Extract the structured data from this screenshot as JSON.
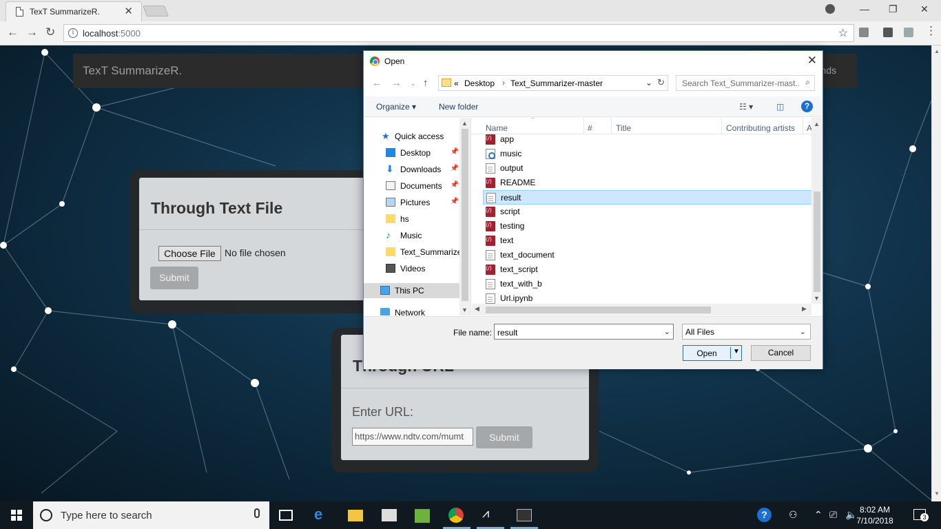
{
  "browser": {
    "tab_title": "TexT SummarizeR.",
    "tab_close": "✕",
    "url_host": "localhost",
    "url_port": ":5000",
    "window_controls": [
      "—",
      "❐",
      "✕"
    ]
  },
  "page": {
    "brand": "TexT SummarizeR.",
    "nav_link_partial": "nds",
    "file_card": {
      "title": "Through Text File",
      "choose_button": "Choose File",
      "status": "No file chosen",
      "submit": "Submit"
    },
    "url_card": {
      "title": "Through URL",
      "label": "Enter URL:",
      "input_value": "https://www.ndtv.com/mumt",
      "submit": "Submit"
    }
  },
  "dialog": {
    "title": "Open",
    "path": [
      "Desktop",
      "Text_Summarizer-master"
    ],
    "path_prefix": "«",
    "search_placeholder": "Search Text_Summarizer-mast...",
    "organize": "Organize ▾",
    "new_folder": "New folder",
    "help": "?",
    "nav_items": [
      {
        "label": "Quick access",
        "icon": "star-icon",
        "pinned": false
      },
      {
        "label": "Desktop",
        "icon": "desktop-icon",
        "pinned": true
      },
      {
        "label": "Downloads",
        "icon": "download-icon",
        "pinned": true
      },
      {
        "label": "Documents",
        "icon": "documents-icon",
        "pinned": true
      },
      {
        "label": "Pictures",
        "icon": "pictures-icon",
        "pinned": true
      },
      {
        "label": "hs",
        "icon": "folder-icon",
        "pinned": false
      },
      {
        "label": "Music",
        "icon": "music-icon",
        "pinned": false
      },
      {
        "label": "Text_Summarize",
        "icon": "folder-icon",
        "pinned": false
      },
      {
        "label": "Videos",
        "icon": "video-icon",
        "pinned": false
      },
      {
        "label": "This PC",
        "icon": "computer-icon",
        "pinned": false
      },
      {
        "label": "Network",
        "icon": "network-icon",
        "pinned": false
      }
    ],
    "columns": [
      "Name",
      "#",
      "Title",
      "Contributing artists",
      "A"
    ],
    "files": [
      {
        "name": "app",
        "icon": "vscode-file-icon"
      },
      {
        "name": "music",
        "icon": "audio-file-icon"
      },
      {
        "name": "output",
        "icon": "text-file-icon"
      },
      {
        "name": "README",
        "icon": "vscode-file-icon"
      },
      {
        "name": "result",
        "icon": "text-file-icon"
      },
      {
        "name": "script",
        "icon": "vscode-file-icon"
      },
      {
        "name": "testing",
        "icon": "vscode-file-icon"
      },
      {
        "name": "text",
        "icon": "vscode-file-icon"
      },
      {
        "name": "text_document",
        "icon": "text-file-icon"
      },
      {
        "name": "text_script",
        "icon": "vscode-file-icon"
      },
      {
        "name": "text_with_b",
        "icon": "text-file-icon"
      },
      {
        "name": "Url.ipynb",
        "icon": "text-file-icon"
      }
    ],
    "selected_file": "result",
    "file_name_label": "File name:",
    "file_name_value": "result",
    "file_type": "All Files",
    "open_button": "Open",
    "cancel_button": "Cancel"
  },
  "taskbar": {
    "search_placeholder": "Type here to search",
    "time": "8:02 AM",
    "date": "7/10/2018",
    "notification_count": "3"
  }
}
